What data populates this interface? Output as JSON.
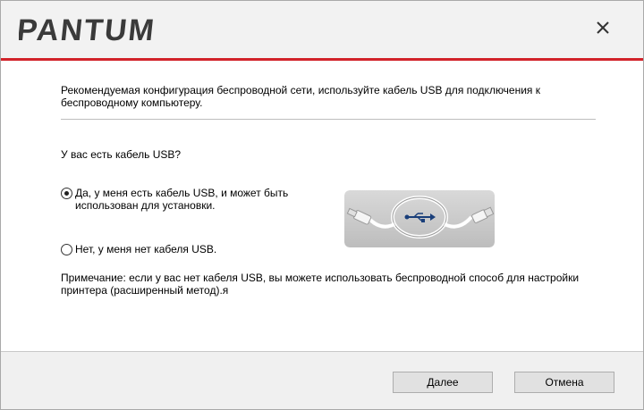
{
  "header": {
    "logo_text": "PANTUM",
    "close_icon": "close-icon",
    "accent_color": "#d2232a"
  },
  "main": {
    "intro": "Рекомендуемая конфигурация беспроводной сети, используйте кабель USB для подключения к беспроводному компьютеру.",
    "question": "У вас есть кабель USB?",
    "options": [
      {
        "label": "Да, у меня есть кабель USB, и может быть использован для установки.",
        "selected": true
      },
      {
        "label": "Нет, у меня нет кабеля USB.",
        "selected": false
      }
    ],
    "note": "Примечание: если у вас нет кабеля USB, вы можете использовать беспроводной способ для настройки принтера (расширенный метод).я",
    "image_icon": "usb-cable-icon"
  },
  "footer": {
    "next_label": "Далее",
    "cancel_label": "Отмена"
  }
}
